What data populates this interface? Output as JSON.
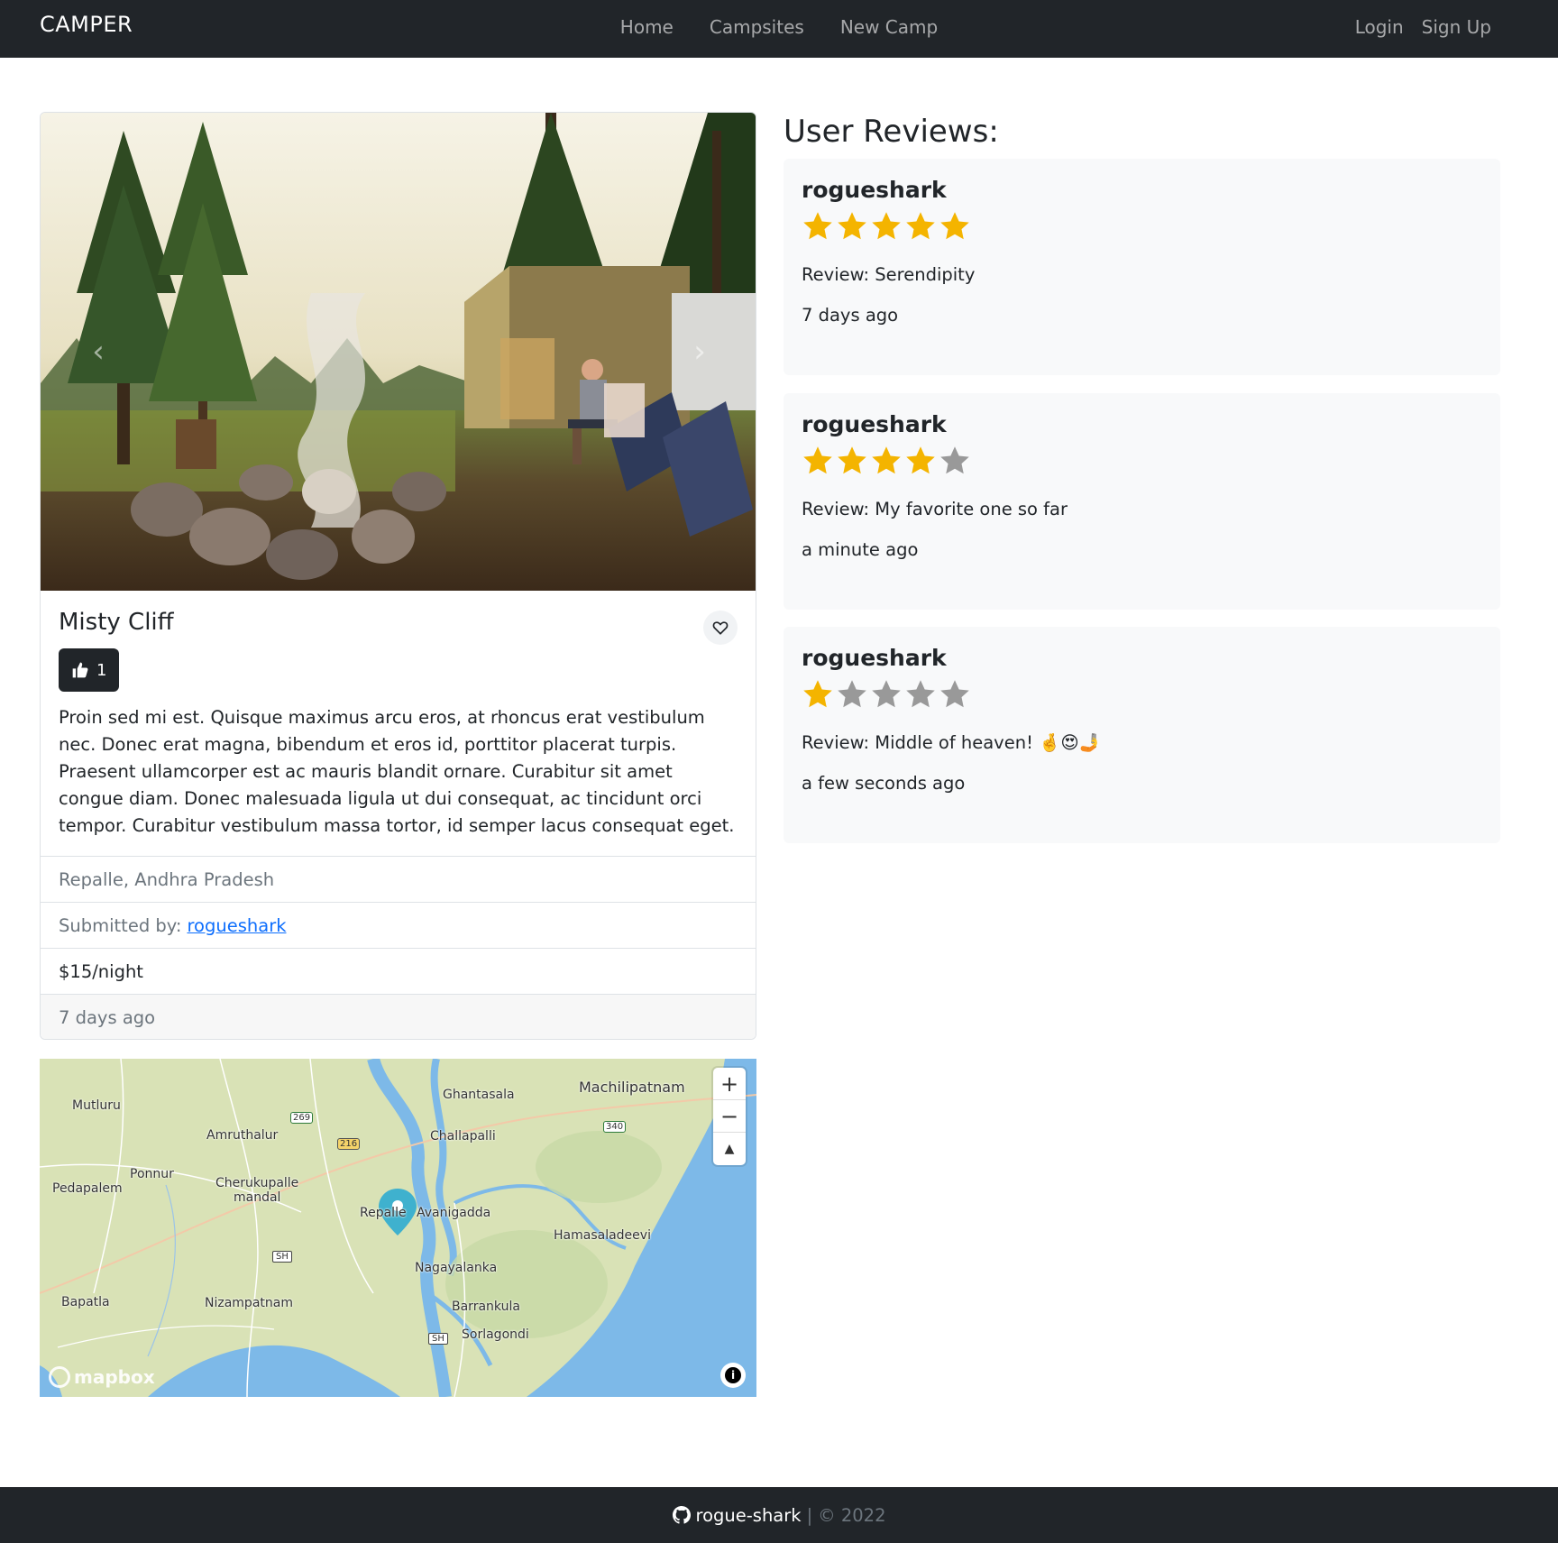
{
  "navbar": {
    "brand": "CAMPER",
    "links": [
      "Home",
      "Campsites",
      "New Camp"
    ],
    "auth": [
      "Login",
      "Sign Up"
    ]
  },
  "camp": {
    "title": "Misty Cliff",
    "likes": "1",
    "description": "Proin sed mi est. Quisque maximus arcu eros, at rhoncus erat vestibulum nec. Donec erat magna, bibendum et eros id, porttitor placerat turpis. Praesent ullamcorper est ac mauris blandit ornare. Curabitur sit amet congue diam. Donec malesuada ligula ut dui consequat, ac tincidunt orci tempor. Curabitur vestibulum massa tortor, id semper lacus consequat eget.",
    "location": "Repalle, Andhra Pradesh",
    "submitted_label": "Submitted by:",
    "author": "rogueshark",
    "price": "$15/night",
    "created": "7 days ago"
  },
  "map": {
    "labels": [
      "Mutluru",
      "Amruthalur",
      "Ponnur",
      "Pedapalem",
      "Cherukupalle",
      "mandal",
      "Repalle",
      "Avanigadda",
      "Ghantasala",
      "Machilipatnam",
      "Challapalli",
      "Hamasaladeevi",
      "Nagayalanka",
      "Bapatla",
      "Nizampatnam",
      "Barrankula",
      "Sorlagondi"
    ],
    "route_shields": [
      "269",
      "216",
      "340",
      "SH",
      "SH"
    ],
    "attribution": "mapbox",
    "zoom_in": "+",
    "zoom_out": "−",
    "compass": "▲",
    "info": "i"
  },
  "reviews": {
    "title": "User Reviews:",
    "items": [
      {
        "author": "rogueshark",
        "rating": 5,
        "text": "Review: Serendipity",
        "time": "7 days ago"
      },
      {
        "author": "rogueshark",
        "rating": 4,
        "text": "Review: My favorite one so far",
        "time": "a minute ago"
      },
      {
        "author": "rogueshark",
        "rating": 1,
        "text": "Review: Middle of heaven! 🤞😍🤳",
        "time": "a few seconds ago"
      }
    ],
    "star_color_on": "#f4b400",
    "star_color_off": "#999999"
  },
  "footer": {
    "github": "rogue-shark",
    "separator": "|",
    "copyright": "© 2022"
  },
  "colors": {
    "navbar_bg": "#212529",
    "link": "#0d6efd",
    "map_water": "#7db9e8",
    "marker": "#3fb1ce"
  }
}
